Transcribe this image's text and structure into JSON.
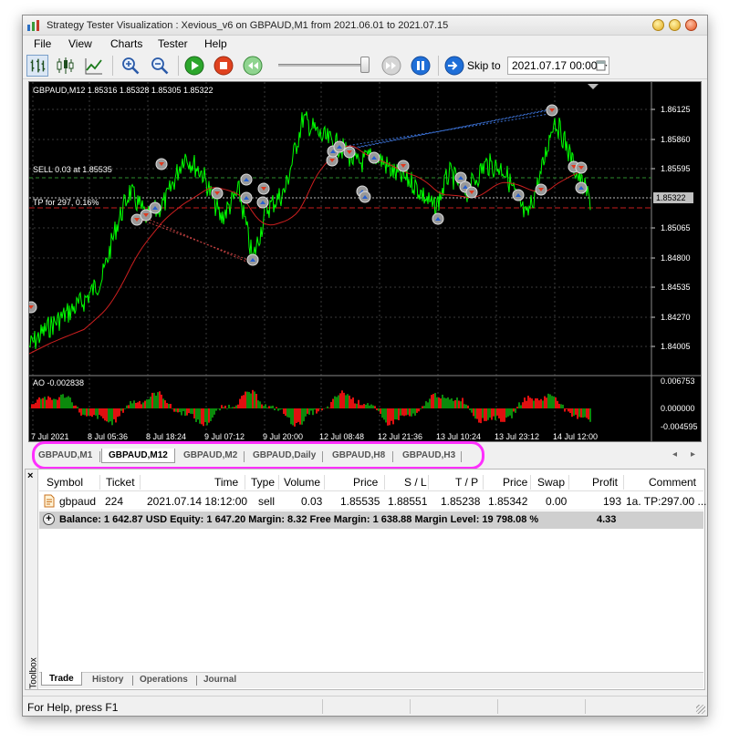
{
  "window": {
    "title": "Strategy Tester Visualization : Xevious_v6 on GBPAUD,M1 from 2021.06.01 to 2021.07.15"
  },
  "menu": [
    "File",
    "View",
    "Charts",
    "Tester",
    "Help"
  ],
  "toolbar": {
    "skip_label": "Skip to",
    "skip_date": "2021.07.17 00:00"
  },
  "chart": {
    "header": "GBPAUD,M12  1.85316 1.85328 1.85305 1.85322",
    "sell_label": "SELL 0.03 at 1.85535",
    "tp_label": "TP for 297, 0.16%",
    "price_ticks": [
      "1.86125",
      "1.85860",
      "1.85595",
      "1.85065",
      "1.84800",
      "1.84535",
      "1.84270",
      "1.84005"
    ],
    "current_price": "1.85322",
    "ao_label": "AO -0.002838",
    "ao_ticks": [
      "0.006753",
      "0.000000",
      "-0.004595"
    ],
    "time_ticks": [
      "7 Jul 2021",
      "8 Jul 05:36",
      "8 Jul 18:24",
      "9 Jul 07:12",
      "9 Jul 20:00",
      "12 Jul 08:48",
      "12 Jul 21:36",
      "13 Jul 10:24",
      "13 Jul 23:12",
      "14 Jul 12:00"
    ],
    "colors": {
      "price": "#00ff00",
      "ma": "#cc1f1f",
      "ao_up": "#0c8a0c",
      "ao_down": "#e01010",
      "background": "#000000"
    }
  },
  "chart_tabs": [
    "GBPAUD,M1",
    "GBPAUD,M12",
    "GBPAUD,M2",
    "GBPAUD,Daily",
    "GBPAUD,H8",
    "GBPAUD,H3"
  ],
  "chart_tab_active": "GBPAUD,M12",
  "toolbox": {
    "side_label": "Toolbox",
    "close": "×",
    "columns": [
      "Symbol",
      "Ticket",
      "Time",
      "Type",
      "Volume",
      "Price",
      "S / L",
      "T / P",
      "Price",
      "Swap",
      "Profit",
      "Comment"
    ],
    "rows": [
      {
        "symbol": "gbpaud",
        "ticket": "224",
        "time": "2021.07.14 18:12:00",
        "type": "sell",
        "volume": "0.03",
        "price": "1.85535",
        "sl": "1.88551",
        "tp": "1.85238",
        "cur_price": "1.85342",
        "swap": "0.00",
        "profit": "193",
        "comment": "1a. TP:297.00 ..."
      }
    ],
    "summary": {
      "text": "Balance: 1 642.87 USD  Equity: 1 647.20  Margin: 8.32  Free Margin: 1 638.88  Margin Level: 19 798.08 %",
      "profit": "4.33"
    },
    "tabs": [
      "Trade",
      "History",
      "Operations",
      "Journal"
    ]
  },
  "status": {
    "text": "For Help, press F1"
  }
}
